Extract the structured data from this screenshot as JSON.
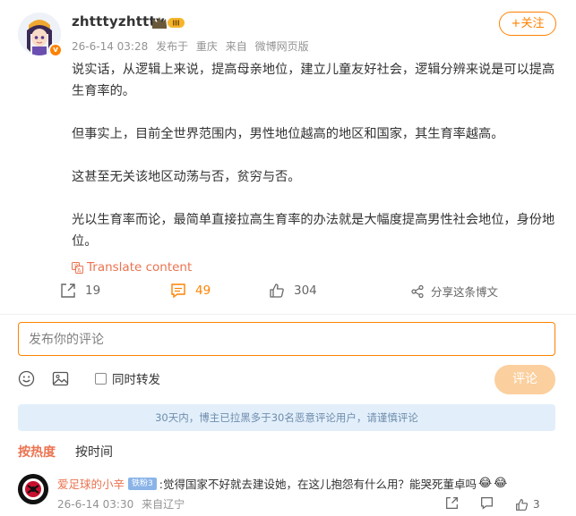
{
  "post": {
    "username": "zhtttyzhttty",
    "level_badge": "III",
    "verified_mark": "v",
    "timestamp": "26-6-14 03:28",
    "posted_from_label": "发布于",
    "location": "重庆",
    "source_label": "来自",
    "source": "微博网页版",
    "follow_label": "+关注",
    "paragraphs": [
      "说实话，从逻辑上来说，提高母亲地位，建立儿童友好社会，逻辑分辨来说是可以提高生育率的。",
      "但事实上，目前全世界范围内，男性地位越高的地区和国家，其生育率越高。",
      "这甚至无关该地区动荡与否，贫穷与否。",
      "光以生育率而论，最简单直接拉高生育率的办法就是大幅度提高男性社会地位，身份地位。"
    ],
    "translate_label": "Translate content",
    "repost_count": "19",
    "comment_count": "49",
    "like_count": "304",
    "share_label": "分享这条博文"
  },
  "comment_box": {
    "placeholder": "发布你的评论",
    "repost_label": "同时转发",
    "submit_label": "评论"
  },
  "notice": "30天内，博主已拉黑多于30名恶意评论用户，请谨慎评论",
  "sort_tabs": [
    "按热度",
    "按时间"
  ],
  "comments": [
    {
      "username": "爱足球的小辛",
      "fan_badge": "铁粉3",
      "text": ":觉得国家不好就去建设她，在这儿抱怨有什么用？能哭死董卓吗",
      "timestamp": "26-6-14 03:30",
      "location": "来自辽宁",
      "like_count": "3"
    }
  ],
  "colors": {
    "accent": "#ff8200",
    "link": "#eb7350",
    "notice_bg": "#e2effb",
    "submit_disabled": "#fbcf9e"
  }
}
